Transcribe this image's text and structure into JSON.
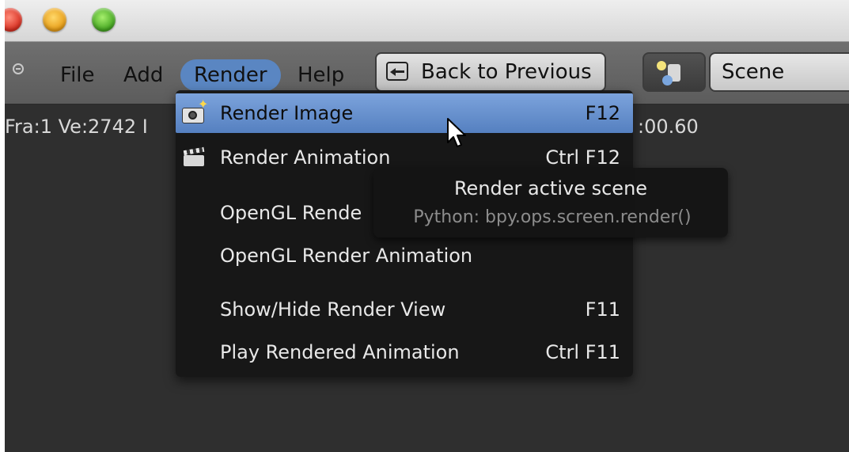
{
  "window": {
    "controls": [
      "close",
      "minimize",
      "maximize"
    ]
  },
  "header": {
    "menu": [
      "File",
      "Add",
      "Render",
      "Help"
    ],
    "active_menu": "Render",
    "back_button_label": "Back to Previous",
    "scene_name": "Scene"
  },
  "status": {
    "left_text": "Fra:1  Ve:2742 I",
    "right_text": ":00.60"
  },
  "render_menu": {
    "items": [
      {
        "label": "Render Image",
        "shortcut": "F12",
        "icon": "camera-icon",
        "active": true
      },
      {
        "label": "Render Animation",
        "shortcut": "Ctrl F12",
        "icon": "clapperboard-icon"
      },
      {
        "label": "OpenGL Render Image",
        "visible_label": "OpenGL Rende",
        "shortcut": ""
      },
      {
        "label": "OpenGL Render Animation",
        "shortcut": ""
      },
      {
        "label": "Show/Hide Render View",
        "shortcut": "F11"
      },
      {
        "label": "Play Rendered Animation",
        "shortcut": "Ctrl F11"
      }
    ]
  },
  "tooltip": {
    "title": "Render active scene",
    "python": "Python: bpy.ops.screen.render()"
  },
  "colors": {
    "highlight": "#5a86c2",
    "menu_bg": "#161616",
    "header_bg": "#666666"
  }
}
